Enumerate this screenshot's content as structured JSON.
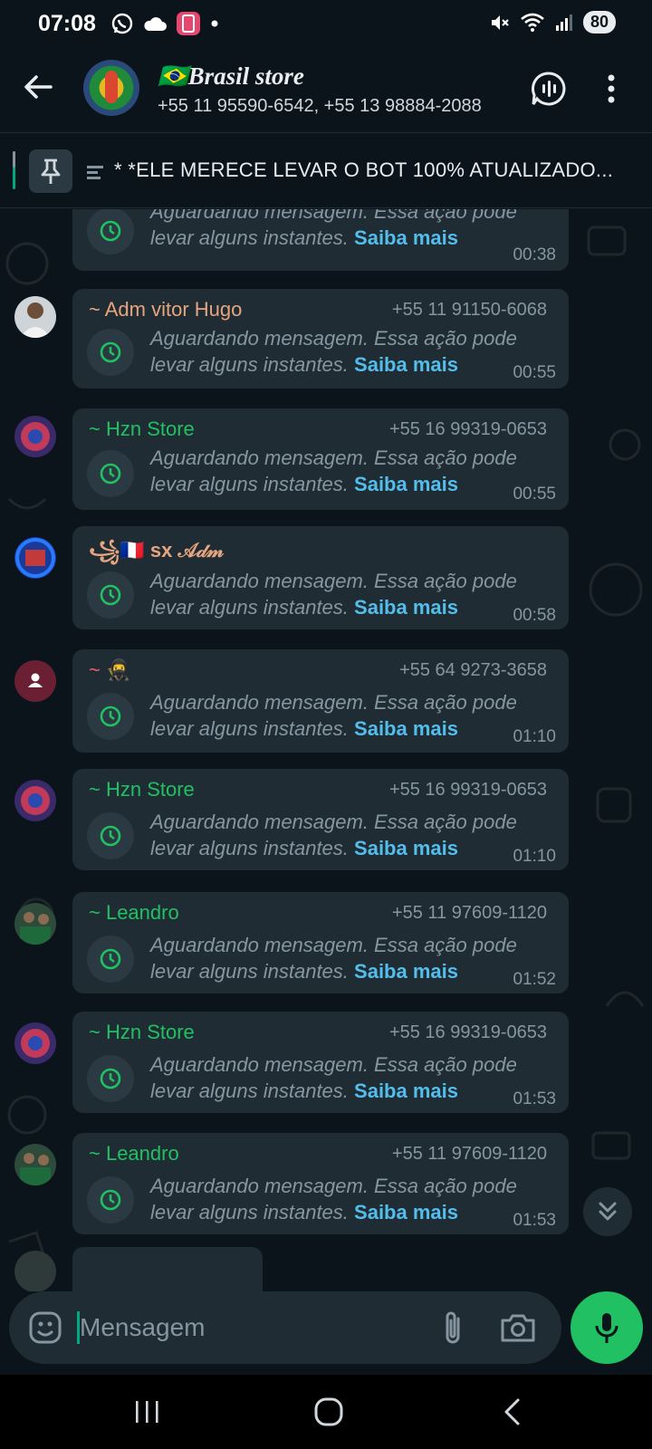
{
  "status_bar": {
    "time": "07:08",
    "battery": "80",
    "icons": [
      "whatsapp-icon",
      "cloud-icon",
      "app-notification-icon",
      "dot-icon",
      "mute-icon",
      "wifi-icon",
      "signal-icon"
    ]
  },
  "header": {
    "title": "🇧🇷Brasil store",
    "subtitle": "+55 11 95590-6542, +55 13 98884-2088",
    "icons": [
      "back-arrow-icon",
      "voice-chat-icon",
      "more-options-icon"
    ]
  },
  "pinned": {
    "text": "* *ELE MERECE LEVAR O BOT 100% ATUALIZADO..."
  },
  "waiting_text": "Aguardando mensagem. Essa ação pode levar alguns instantes.",
  "learn_more": "Saiba mais",
  "messages": [
    {
      "sender": "",
      "phone": "",
      "time": "00:38",
      "sender_color": "#ffffff"
    },
    {
      "sender": "~ Adm vitor Hugo",
      "phone": "+55 11 91150-6068",
      "time": "00:55",
      "sender_color": "#e6a57e"
    },
    {
      "sender": "~ Hzn Store",
      "phone": "+55 16 99319-0653",
      "time": "00:55",
      "sender_color": "#21c063"
    },
    {
      "sender": "꧁🇫🇷 sx 𝒜𝒹𝓂",
      "phone": "",
      "time": "00:58",
      "sender_color": "#e6a57e"
    },
    {
      "sender": "~ 🥷",
      "phone": "+55 64 9273-3658",
      "time": "01:10",
      "sender_color": "#f15c6d"
    },
    {
      "sender": "~ Hzn Store",
      "phone": "+55 16 99319-0653",
      "time": "01:10",
      "sender_color": "#21c063"
    },
    {
      "sender": "~ Leandro",
      "phone": "+55 11 97609-1120",
      "time": "01:52",
      "sender_color": "#21c063"
    },
    {
      "sender": "~ Hzn Store",
      "phone": "+55 16 99319-0653",
      "time": "01:53",
      "sender_color": "#21c063"
    },
    {
      "sender": "~ Leandro",
      "phone": "+55 11 97609-1120",
      "time": "01:53",
      "sender_color": "#21c063"
    }
  ],
  "composer": {
    "placeholder": "Mensagem",
    "icons": [
      "emoji-icon",
      "attach-icon",
      "camera-icon",
      "mic-icon"
    ]
  },
  "colors": {
    "background": "#0b141a",
    "bubble": "#202c33",
    "accent": "#00a884",
    "link": "#53bdeb",
    "mic_button": "#21c063"
  }
}
